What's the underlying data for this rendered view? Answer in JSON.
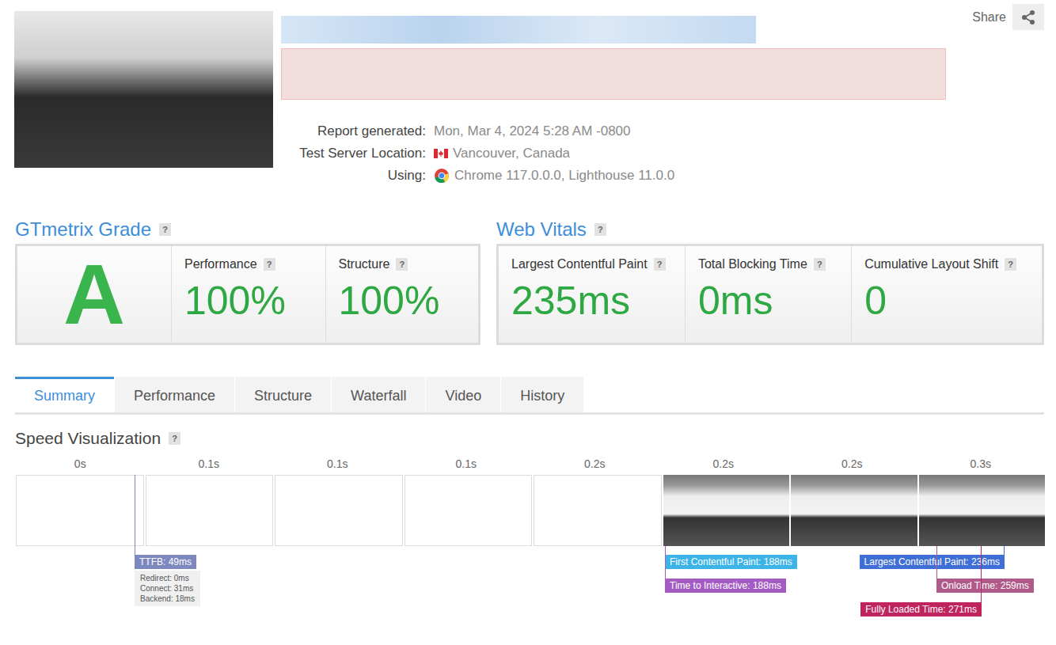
{
  "header": {
    "share": "Share"
  },
  "report_info": [
    {
      "label": "Report generated:",
      "value": "Mon, Mar 4, 2024 5:28 AM -0800",
      "kind": "text"
    },
    {
      "label": "Test Server Location:",
      "value": "Vancouver, Canada",
      "kind": "flag"
    },
    {
      "label": "Using:",
      "value": "Chrome 117.0.0.0, Lighthouse 11.0.0",
      "kind": "browser"
    }
  ],
  "grade": {
    "title": "GTmetrix Grade",
    "help": "?",
    "letter": "A",
    "metrics": [
      {
        "label": "Performance",
        "help": "?",
        "value": "100%"
      },
      {
        "label": "Structure",
        "help": "?",
        "value": "100%"
      }
    ]
  },
  "web_vitals": {
    "title": "Web Vitals",
    "help": "?",
    "metrics": [
      {
        "label": "Largest Contentful Paint",
        "help": "?",
        "value": "235ms"
      },
      {
        "label": "Total Blocking Time",
        "help": "?",
        "value": "0ms"
      },
      {
        "label": "Cumulative Layout Shift",
        "help": "?",
        "value": "0"
      }
    ]
  },
  "tabs": [
    {
      "label": "Summary",
      "selected": true
    },
    {
      "label": "Performance",
      "selected": false
    },
    {
      "label": "Structure",
      "selected": false
    },
    {
      "label": "Waterfall",
      "selected": false
    },
    {
      "label": "Video",
      "selected": false
    },
    {
      "label": "History",
      "selected": false
    }
  ],
  "speed_visualization": {
    "title": "Speed Visualization",
    "help": "?",
    "ticks": [
      "0s",
      "0.1s",
      "0.1s",
      "0.1s",
      "0.2s",
      "0.2s",
      "0.2s",
      "0.3s"
    ],
    "frames": [
      {
        "kind": "blank"
      },
      {
        "kind": "blank"
      },
      {
        "kind": "blank"
      },
      {
        "kind": "blank"
      },
      {
        "kind": "blank"
      },
      {
        "kind": "image"
      },
      {
        "kind": "image"
      },
      {
        "kind": "image"
      }
    ],
    "markers": [
      {
        "label": "TTFB: 49ms",
        "color": "#7d88bf",
        "details": [
          "Redirect: 0ms",
          "Connect: 31ms",
          "Backend: 18ms"
        ]
      },
      {
        "label": "First Contentful Paint: 188ms",
        "color": "#3cb4e8",
        "details": []
      },
      {
        "label": "Time to Interactive: 188ms",
        "color": "#a45cc4",
        "details": []
      },
      {
        "label": "Largest Contentful Paint: 236ms",
        "color": "#3f6fd6",
        "details": []
      },
      {
        "label": "Onload Time: 259ms",
        "color": "#b05a8a",
        "details": []
      },
      {
        "label": "Fully Loaded Time: 271ms",
        "color": "#c0245e",
        "details": []
      }
    ]
  }
}
